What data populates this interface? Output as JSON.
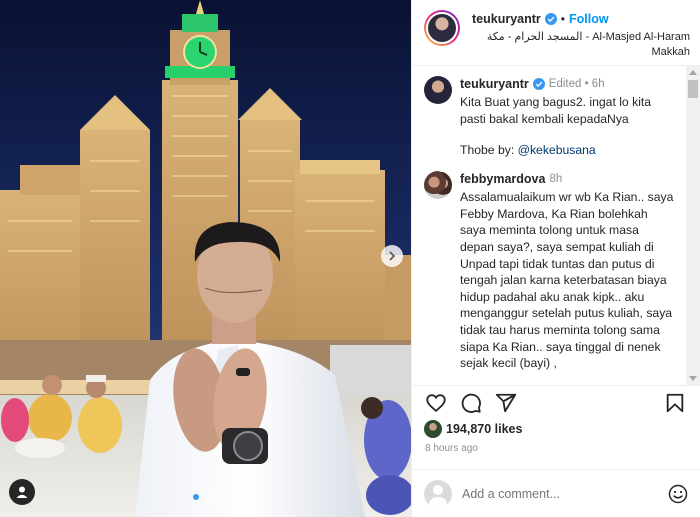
{
  "post": {
    "author": "teukuryantr",
    "follow_label": "Follow",
    "separator": "•",
    "location_line1": "المسجد الحرام - مكة - Al-Masjed Al-Haram",
    "location_line2": "Makkah",
    "image_alt": "Photo of a man praying in front of the Makkah clock tower",
    "carousel": {
      "total": 3,
      "active": 1
    }
  },
  "comments": [
    {
      "user": "teukuryantr",
      "verified": true,
      "meta": "Edited • 6h",
      "text": "Kita Buat yang bagus2. ingat lo kita pasti bakal kembali kepadaNya",
      "extra_prefix": "Thobe by: ",
      "extra_mention": "@kekebusana"
    },
    {
      "user": "febbymardova",
      "verified": false,
      "meta": "8h",
      "text": "Assalamualaikum wr wb Ka Rian.. saya Febby Mardova, Ka Rian bolehkah saya meminta tolong untuk masa depan saya?, saya sempat kuliah di Unpad tapi tidak tuntas dan putus di tengah jalan karna keterbatasan biaya hidup padahal aku anak kipk.. aku menganggur setelah putus kuliah, saya tidak tau harus meminta tolong sama siapa Ka Rian.. saya tinggal di nenek sejak kecil (bayi) ,"
    }
  ],
  "likes": {
    "count": "194,870 likes"
  },
  "time": "8 hours ago",
  "add_comment": {
    "placeholder": "Add a comment..."
  },
  "icons": {
    "like": "heart-icon",
    "comment": "comment-icon",
    "share": "share-icon",
    "save": "bookmark-icon",
    "emoji": "emoji-icon",
    "next": "chevron-right-icon",
    "tag": "user-tag-icon"
  },
  "colors": {
    "accent": "#0095f6",
    "verified": "#3897f0",
    "muted": "#8e8e8e",
    "text": "#262626"
  }
}
